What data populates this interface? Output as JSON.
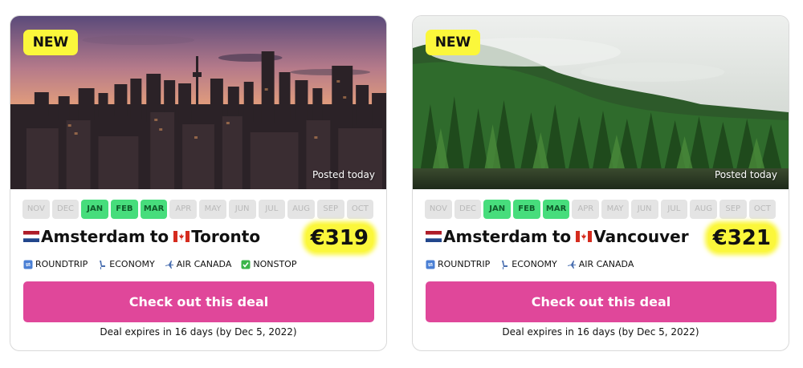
{
  "deals": [
    {
      "badge": "NEW",
      "posted": "Posted today",
      "months": [
        {
          "label": "NOV",
          "active": false
        },
        {
          "label": "DEC",
          "active": false
        },
        {
          "label": "JAN",
          "active": true
        },
        {
          "label": "FEB",
          "active": true
        },
        {
          "label": "MAR",
          "active": true
        },
        {
          "label": "APR",
          "active": false
        },
        {
          "label": "MAY",
          "active": false
        },
        {
          "label": "JUN",
          "active": false
        },
        {
          "label": "JUL",
          "active": false
        },
        {
          "label": "AUG",
          "active": false
        },
        {
          "label": "SEP",
          "active": false
        },
        {
          "label": "OCT",
          "active": false
        }
      ],
      "origin": "Amsterdam",
      "connector": "to",
      "destination": "Toronto",
      "price": "€319",
      "tags": [
        {
          "icon": "roundtrip-icon",
          "label": "ROUNDTRIP"
        },
        {
          "icon": "seat-icon",
          "label": "ECONOMY"
        },
        {
          "icon": "airplane-icon",
          "label": "AIR CANADA"
        },
        {
          "icon": "check-icon",
          "label": "NONSTOP"
        }
      ],
      "cta": "Check out this deal",
      "expires": "Deal expires in 16 days (by Dec 5, 2022)",
      "image": "toronto-skyline-sunset"
    },
    {
      "badge": "NEW",
      "posted": "Posted today",
      "months": [
        {
          "label": "NOV",
          "active": false
        },
        {
          "label": "DEC",
          "active": false
        },
        {
          "label": "JAN",
          "active": true
        },
        {
          "label": "FEB",
          "active": true
        },
        {
          "label": "MAR",
          "active": true
        },
        {
          "label": "APR",
          "active": false
        },
        {
          "label": "MAY",
          "active": false
        },
        {
          "label": "JUN",
          "active": false
        },
        {
          "label": "JUL",
          "active": false
        },
        {
          "label": "AUG",
          "active": false
        },
        {
          "label": "SEP",
          "active": false
        },
        {
          "label": "OCT",
          "active": false
        }
      ],
      "origin": "Amsterdam",
      "connector": "to",
      "destination": "Vancouver",
      "price": "€321",
      "tags": [
        {
          "icon": "roundtrip-icon",
          "label": "ROUNDTRIP"
        },
        {
          "icon": "seat-icon",
          "label": "ECONOMY"
        },
        {
          "icon": "airplane-icon",
          "label": "AIR CANADA"
        }
      ],
      "cta": "Check out this deal",
      "expires": "Deal expires in 16 days (by Dec 5, 2022)",
      "image": "misty-forest-lake"
    }
  ],
  "colors": {
    "badge_yellow": "#fbf73b",
    "month_active": "#47dd7c",
    "month_inactive": "#e4e4e4",
    "cta_pink": "#e0479a"
  }
}
